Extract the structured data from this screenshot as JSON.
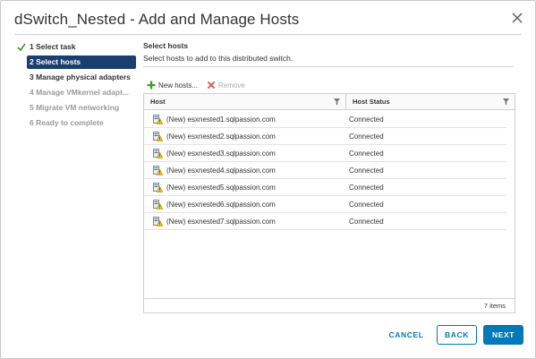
{
  "dialog": {
    "title": "dSwitch_Nested - Add and Manage Hosts"
  },
  "steps": [
    {
      "label": "1 Select task",
      "state": "done"
    },
    {
      "label": "2 Select hosts",
      "state": "active"
    },
    {
      "label": "3 Manage physical adapters",
      "state": "enabled"
    },
    {
      "label": "4 Manage VMkernel adapt...",
      "state": "disabled"
    },
    {
      "label": "5 Migrate VM networking",
      "state": "disabled"
    },
    {
      "label": "6 Ready to complete",
      "state": "disabled"
    }
  ],
  "content": {
    "title": "Select hosts",
    "description": "Select hosts to add to this distributed switch."
  },
  "toolbar": {
    "new_hosts_label": "New hosts...",
    "remove_label": "Remove"
  },
  "grid": {
    "columns": {
      "host": "Host",
      "status": "Host Status"
    },
    "rows": [
      {
        "host": "(New) esxnested1.sqlpassion.com",
        "status": "Connected"
      },
      {
        "host": "(New) esxnested2.sqlpassion.com",
        "status": "Connected"
      },
      {
        "host": "(New) esxnested3.sqlpassion.com",
        "status": "Connected"
      },
      {
        "host": "(New) esxnested4.sqlpassion.com",
        "status": "Connected"
      },
      {
        "host": "(New) esxnested5.sqlpassion.com",
        "status": "Connected"
      },
      {
        "host": "(New) esxnested6.sqlpassion.com",
        "status": "Connected"
      },
      {
        "host": "(New) esxnested7.sqlpassion.com",
        "status": "Connected"
      }
    ],
    "footer_count": "7 items"
  },
  "buttons": {
    "cancel": "CANCEL",
    "back": "BACK",
    "next": "NEXT"
  },
  "colors": {
    "primary": "#0079b8",
    "active_step": "#1a3f6e",
    "add_icon": "#3a9a2a",
    "remove_icon": "#e06060"
  }
}
